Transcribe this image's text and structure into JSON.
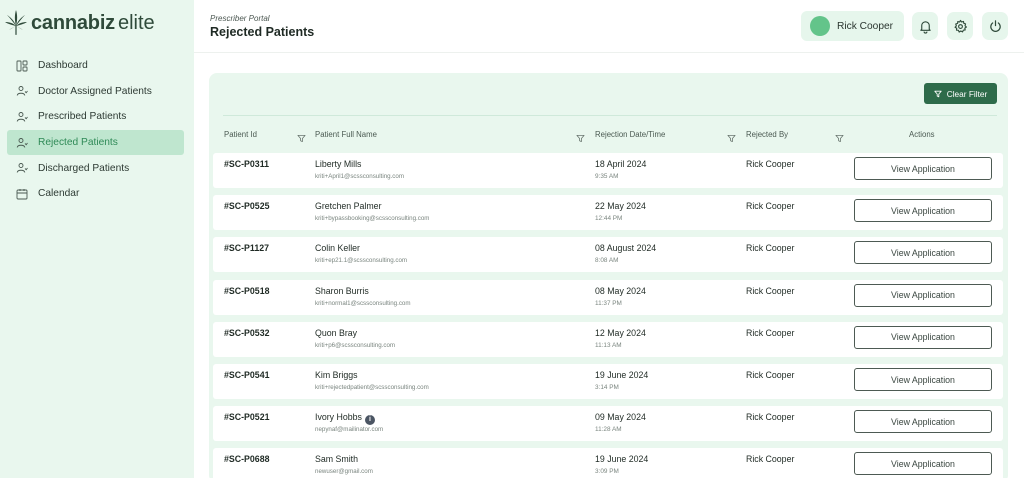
{
  "brand": {
    "name_bold": "cannabiz",
    "name_light": "elite"
  },
  "sidebar": {
    "items": [
      {
        "label": "Dashboard",
        "icon": "dashboard-icon",
        "active": false
      },
      {
        "label": "Doctor Assigned Patients",
        "icon": "user-icon",
        "active": false
      },
      {
        "label": "Prescribed Patients",
        "icon": "user-icon",
        "active": false
      },
      {
        "label": "Rejected Patients",
        "icon": "user-icon",
        "active": true
      },
      {
        "label": "Discharged Patients",
        "icon": "user-icon",
        "active": false
      },
      {
        "label": "Calendar",
        "icon": "calendar-icon",
        "active": false
      }
    ]
  },
  "header": {
    "portal": "Prescriber Portal",
    "title": "Rejected Patients",
    "user_name": "Rick Cooper",
    "icons": [
      "bell-icon",
      "gear-icon",
      "power-icon"
    ]
  },
  "toolbar": {
    "clear_filter": "Clear Filter"
  },
  "table": {
    "columns": {
      "patient_id": "Patient Id",
      "full_name": "Patient Full Name",
      "rejection_date": "Rejection Date/Time",
      "rejected_by": "Rejected By",
      "actions": "Actions"
    },
    "action_label": "View Application",
    "rows": [
      {
        "id": "#SC-P0311",
        "name": "Liberty Mills",
        "email": "kriti+April1@scssconsulting.com",
        "date": "18 April 2024",
        "time": "9:35 AM",
        "by": "Rick Cooper"
      },
      {
        "id": "#SC-P0525",
        "name": "Gretchen Palmer",
        "email": "kriti+bypassbooking@scssconsulting.com",
        "date": "22 May 2024",
        "time": "12:44 PM",
        "by": "Rick Cooper"
      },
      {
        "id": "#SC-P1127",
        "name": "Colin Keller",
        "email": "kriti+ep21.1@scssconsulting.com",
        "date": "08 August 2024",
        "time": "8:08 AM",
        "by": "Rick Cooper"
      },
      {
        "id": "#SC-P0518",
        "name": "Sharon Burris",
        "email": "kriti+normal1@scssconsulting.com",
        "date": "08 May 2024",
        "time": "11:37 PM",
        "by": "Rick Cooper"
      },
      {
        "id": "#SC-P0532",
        "name": "Quon Bray",
        "email": "kriti+p6@scssconsulting.com",
        "date": "12 May 2024",
        "time": "11:13 AM",
        "by": "Rick Cooper"
      },
      {
        "id": "#SC-P0541",
        "name": "Kim Briggs",
        "email": "kriti+rejectedpatient@scssconsulting.com",
        "date": "19 June 2024",
        "time": "3:14 PM",
        "by": "Rick Cooper"
      },
      {
        "id": "#SC-P0521",
        "name": "Ivory Hobbs",
        "email": "nepynaf@mailinator.com",
        "date": "09 May 2024",
        "time": "11:28 AM",
        "by": "Rick Cooper",
        "info": "i"
      },
      {
        "id": "#SC-P0688",
        "name": "Sam Smith",
        "email": "newuser@gmail.com",
        "date": "19 June 2024",
        "time": "3:09 PM",
        "by": "Rick Cooper"
      }
    ]
  },
  "colors": {
    "accent": "#2e6b4a",
    "sidebar_bg": "#e9f7ee",
    "active_bg": "#bfe6cf",
    "avatar": "#63c48a"
  }
}
